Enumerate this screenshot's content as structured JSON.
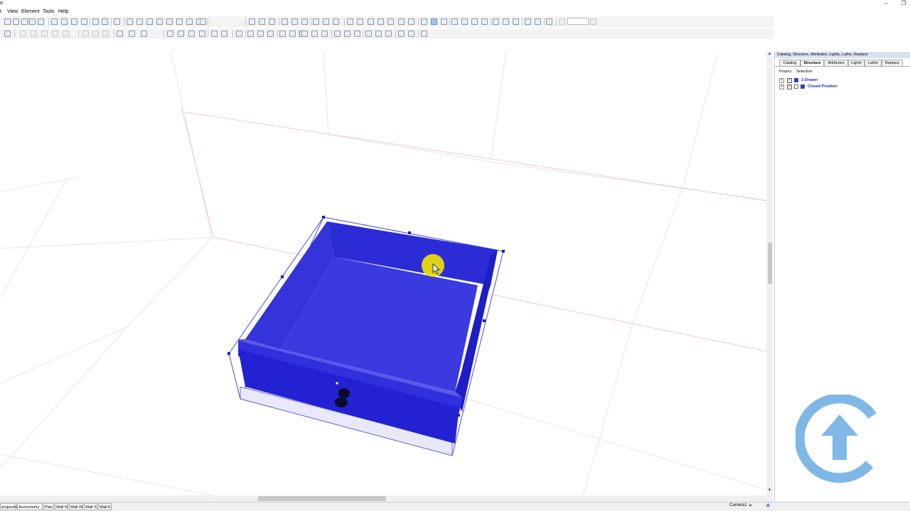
{
  "window": {
    "title_fragment": "o",
    "minimize": "–",
    "restore": "❐"
  },
  "menu": {
    "items": [
      "t",
      "View",
      "Element",
      "Tools",
      "Help"
    ]
  },
  "panel": {
    "title": "Catalog, Structure, Attributes, Lights, Lathe, Replace",
    "tabs": [
      "Catalog",
      "Structure",
      "Attributes",
      "Lights",
      "Lathe",
      "Replace"
    ],
    "active_tab": "Structure",
    "subtabs": [
      "Project",
      "Selection"
    ],
    "tree": [
      {
        "label": "1-Drawer"
      },
      {
        "label": "Closed Position"
      }
    ]
  },
  "view_tabs": [
    "erspective",
    "Axonometry",
    "Plan",
    "Wall N",
    "Wall W",
    "Wall S",
    "Wall E"
  ],
  "camera": {
    "label": "Camera1",
    "close": "✕"
  },
  "colors": {
    "drawer_blue": "#2222dd",
    "panel_header": "#d6e3f2",
    "logo_blue": "#7fb8e6",
    "cursor_yellow": "#f2e600"
  }
}
